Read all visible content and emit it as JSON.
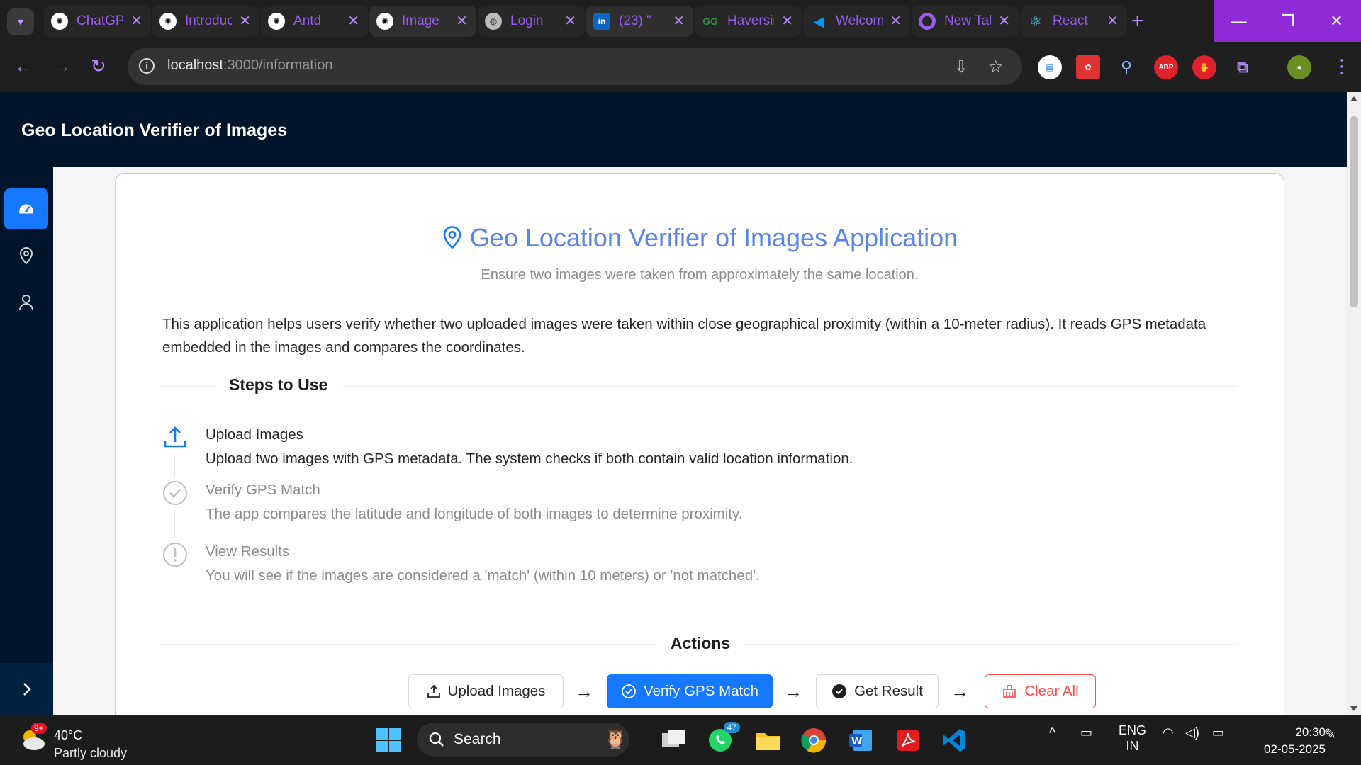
{
  "browser": {
    "tabs": [
      {
        "title": "ChatGPT",
        "icon": "openai-icon",
        "color": "#ffffff"
      },
      {
        "title": "Introduction",
        "icon": "openai-icon",
        "color": "#ffffff"
      },
      {
        "title": "Antd",
        "icon": "openai-icon",
        "color": "#ffffff"
      },
      {
        "title": "Image",
        "icon": "openai-icon",
        "color": "#ffffff"
      },
      {
        "title": "Login",
        "icon": "globe-icon",
        "color": "#ffffff"
      },
      {
        "title": "(23) \"",
        "icon": "linkedin-icon",
        "color": "#0a66c2"
      },
      {
        "title": "Haversine",
        "icon": "geeksforgeeks-icon",
        "color": "#2f8d46"
      },
      {
        "title": "Welcome",
        "icon": "vscode-icon",
        "color": "#0078d4"
      },
      {
        "title": "New Tab",
        "icon": "chrome-icon",
        "color": "#9a5cf0"
      },
      {
        "title": "React",
        "icon": "react-icon",
        "color": "#61dafb"
      }
    ],
    "url_host": "localhost",
    "url_path": ":3000/information",
    "extensions": [
      "docs-icon",
      "extension-icon",
      "search-icon",
      "adblock-icon",
      "hand-icon",
      "puzzle-icon",
      "avatar"
    ]
  },
  "app": {
    "header_title": "Geo Location Verifier of Images",
    "title": "Geo Location Verifier of Images Application",
    "subtitle": "Ensure two images were taken from approximately the same location.",
    "description": "This application helps users verify whether two uploaded images were taken within close geographical proximity (within a 10-meter radius). It reads GPS metadata embedded in the images and compares the coordinates.",
    "steps_heading": "Steps to Use",
    "steps": [
      {
        "title": "Upload Images",
        "description": "Upload two images with GPS metadata. The system checks if both contain valid location information.",
        "status": "process"
      },
      {
        "title": "Verify GPS Match",
        "description": "The app compares the latitude and longitude of both images to determine proximity.",
        "status": "wait"
      },
      {
        "title": "View Results",
        "description": "You will see if the images are considered a 'match' (within 10 meters) or 'not matched'.",
        "status": "wait"
      }
    ],
    "actions_heading": "Actions",
    "actions": {
      "upload": "Upload Images",
      "verify": "Verify GPS Match",
      "result": "Get Result",
      "clear": "Clear All"
    },
    "colors": {
      "primary": "#1677ff",
      "header": "#001529",
      "title": "#5b84e8",
      "danger": "#ff4d4f"
    }
  },
  "taskbar": {
    "weather_temp": "40°C",
    "weather_cond": "Partly cloudy",
    "weather_badge": "9+",
    "search": "Search",
    "whatsapp_badge": "47",
    "lang1": "ENG",
    "lang2": "IN",
    "time": "20:30",
    "date": "02-05-2025"
  }
}
